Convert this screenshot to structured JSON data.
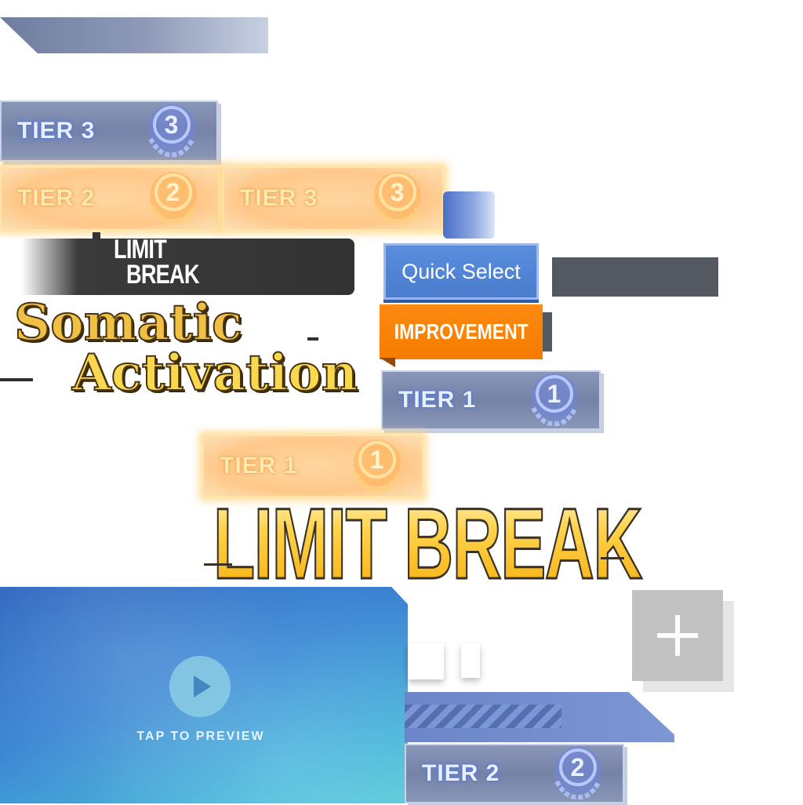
{
  "tiers": {
    "blue_tier3": {
      "label": "TIER 3",
      "number": "3"
    },
    "gold_tier2": {
      "label": "TIER 2",
      "number": "2"
    },
    "gold_tier3": {
      "label": "TIER 3",
      "number": "3"
    },
    "blue_tier1": {
      "label": "TIER 1",
      "number": "1"
    },
    "gold_tier1": {
      "label": "TIER 1",
      "number": "1"
    },
    "blue_tier2": {
      "label": "TIER 2",
      "number": "2"
    }
  },
  "limit_break_small": {
    "line1": "LIMIT",
    "line2": "BREAK"
  },
  "title": {
    "line1": "Somatic",
    "line2": "Activation"
  },
  "quick_select": {
    "label": "Quick Select"
  },
  "improvement": {
    "label": "IMPROVEMENT"
  },
  "limit_break_big": {
    "label": "LIMIT BREAK"
  },
  "preview": {
    "label": "TAP TO PREVIEW"
  },
  "colors": {
    "tier_blue": "#7583a8",
    "tier_gold": "#ffc88a",
    "quick_select_blue": "#4a7bcc",
    "improvement_orange": "#f47c00",
    "limit_break_gold": "#ffd24a"
  },
  "icons": [
    "laurel-medal-icon",
    "play-icon",
    "plus-icon"
  ]
}
